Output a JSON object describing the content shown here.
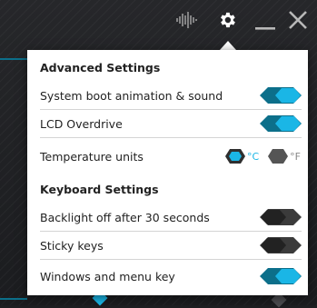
{
  "colors": {
    "accent": "#1ab6e6",
    "accent_dark": "#0c6f8a",
    "toggle_off": "#3b3b3b"
  },
  "titlebar": {
    "icons": [
      "audio-wave-icon",
      "gear-icon",
      "minimize-icon",
      "close-icon"
    ]
  },
  "settings_panel": {
    "advanced_header": "Advanced Settings",
    "keyboard_header": "Keyboard Settings",
    "rows": [
      {
        "label": "System boot animation & sound",
        "state": "on"
      },
      {
        "label": "LCD Overdrive",
        "state": "on"
      },
      {
        "label": "Temperature units",
        "selected": "°C",
        "options": [
          "°C",
          "°F"
        ]
      },
      {
        "label": "Backlight off after 30 seconds",
        "state": "off"
      },
      {
        "label": "Sticky keys",
        "state": "off"
      },
      {
        "label": "Windows and menu key",
        "state": "on"
      }
    ]
  }
}
